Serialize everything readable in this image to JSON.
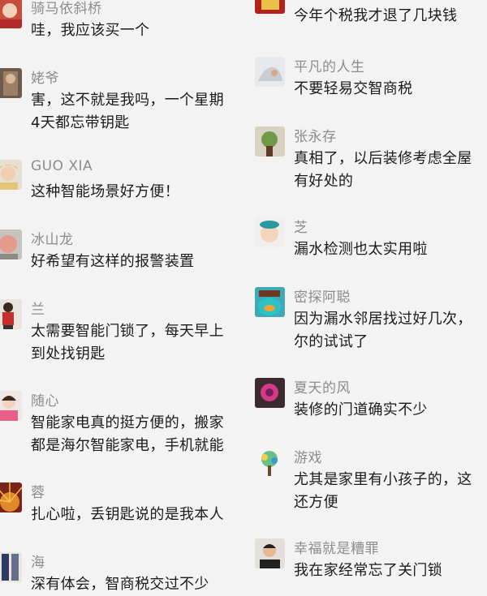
{
  "left_comments": [
    {
      "name": "骑马依斜桥",
      "lines": [
        "哇，我应该买一个"
      ]
    },
    {
      "name": "姥爷",
      "lines": [
        "害，这不就是我吗，一个星期",
        "4天都忘带钥匙"
      ]
    },
    {
      "name": "GUO XIA",
      "lines": [
        "这种智能场景好方便！"
      ]
    },
    {
      "name": "冰山龙",
      "lines": [
        "好希望有这样的报警装置"
      ]
    },
    {
      "name": "兰",
      "lines": [
        "太需要智能门锁了，每天早上",
        "到处找钥匙"
      ]
    },
    {
      "name": "随心",
      "lines": [
        "智能家电真的挺方便的，搬家",
        "都是海尔智能家电，手机就能"
      ]
    },
    {
      "name": "蓉",
      "lines": [
        "扎心啦，丢钥匙说的是我本人"
      ]
    },
    {
      "name": "海",
      "lines": [
        "深有体会，智商税交过不少"
      ]
    }
  ],
  "right_comments": [
    {
      "name": "",
      "lines": [
        "今年个税我才退了几块钱"
      ]
    },
    {
      "name": "平凡的人生",
      "lines": [
        "不要轻易交智商税"
      ]
    },
    {
      "name": "张永存",
      "lines": [
        "真相了，以后装修考虑全屋",
        "有好处的"
      ]
    },
    {
      "name": "芝",
      "lines": [
        "漏水检测也太实用啦"
      ]
    },
    {
      "name": "密探阿聪",
      "lines": [
        "因为漏水邻居找过好几次，",
        "尔的试试了"
      ]
    },
    {
      "name": "夏天的风",
      "lines": [
        "装修的门道确实不少"
      ]
    },
    {
      "name": "游戏",
      "lines": [
        "尤其是家里有小孩子的，这",
        "还方便"
      ]
    },
    {
      "name": "幸福就是糟罪",
      "lines": [
        "我在家经常忘了关门锁"
      ]
    }
  ]
}
